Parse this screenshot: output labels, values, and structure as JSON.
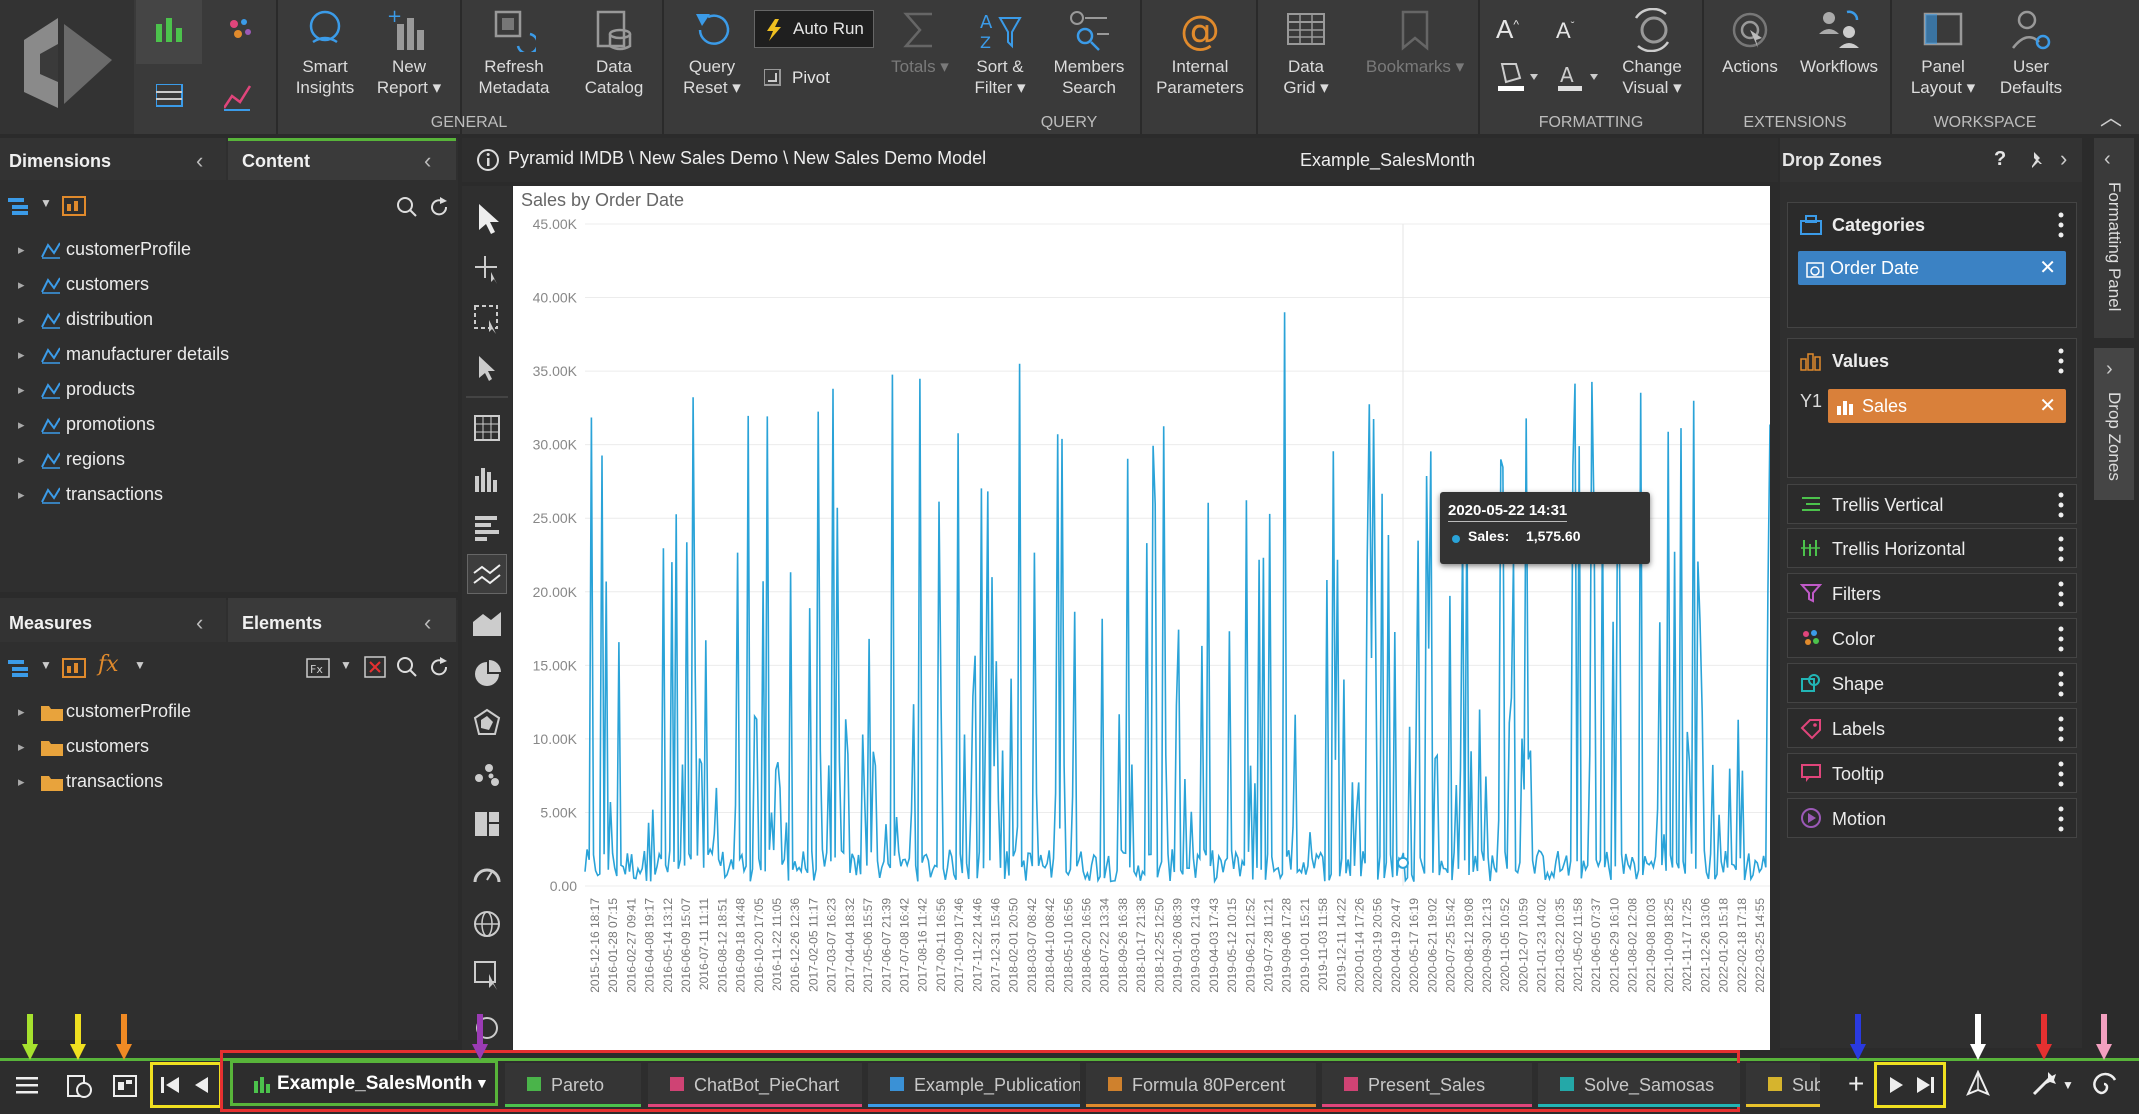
{
  "ribbon": {
    "buttons": [
      {
        "id": "smart-insights",
        "line1": "Smart",
        "line2": "Insights"
      },
      {
        "id": "new-report",
        "line1": "New",
        "line2": "Report ▾"
      },
      {
        "id": "refresh-metadata",
        "line1": "Refresh",
        "line2": "Metadata"
      },
      {
        "id": "data-catalog",
        "line1": "Data",
        "line2": "Catalog"
      },
      {
        "id": "query-reset",
        "line1": "Query",
        "line2": "Reset ▾"
      },
      {
        "id": "totals",
        "line1": "Totals ▾",
        "line2": ""
      },
      {
        "id": "sort-filter",
        "line1": "Sort &",
        "line2": "Filter ▾"
      },
      {
        "id": "members-search",
        "line1": "Members",
        "line2": "Search"
      },
      {
        "id": "internal-parameters",
        "line1": "Internal",
        "line2": "Parameters"
      },
      {
        "id": "data-grid",
        "line1": "Data",
        "line2": "Grid ▾"
      },
      {
        "id": "bookmarks",
        "line1": "Bookmarks ▾",
        "line2": ""
      },
      {
        "id": "change-visual",
        "line1": "Change",
        "line2": "Visual ▾"
      },
      {
        "id": "actions",
        "line1": "Actions",
        "line2": ""
      },
      {
        "id": "workflows",
        "line1": "Workflows",
        "line2": ""
      },
      {
        "id": "panel-layout",
        "line1": "Panel",
        "line2": "Layout ▾"
      },
      {
        "id": "user-defaults",
        "line1": "User",
        "line2": "Defaults"
      }
    ],
    "auto_run": "Auto Run",
    "pivot": "Pivot",
    "groups": {
      "general": "GENERAL",
      "query": "QUERY",
      "formatting": "FORMATTING",
      "extensions": "EXTENSIONS",
      "workspace": "WORKSPACE"
    },
    "font_up": "A",
    "font_down": "A"
  },
  "left": {
    "dimensions_title": "Dimensions",
    "content_title": "Content",
    "dimensions": [
      "customerProfile",
      "customers",
      "distribution",
      "manufacturer details",
      "products",
      "promotions",
      "regions",
      "transactions"
    ],
    "measures_title": "Measures",
    "elements_title": "Elements",
    "measures": [
      "customerProfile",
      "customers",
      "transactions"
    ]
  },
  "breadcrumb": "Pyramid IMDB \\ New Sales Demo \\ New Sales Demo Model",
  "report_name": "Example_SalesMonth",
  "chart_data": {
    "type": "line",
    "title": "Sales by Order Date",
    "ylim": [
      0,
      45000
    ],
    "yticks": [
      "45.00K",
      "40.00K",
      "35.00K",
      "30.00K",
      "25.00K",
      "20.00K",
      "15.00K",
      "10.00K",
      "5.00K",
      "0.00"
    ],
    "xticks": [
      "2015-12-16 18:17",
      "2016-01-28 07:15",
      "2016-02-27 09:41",
      "2016-04-08 19:17",
      "2016-05-14 13:12",
      "2016-06-09 15:07",
      "2016-07-11 11:11",
      "2016-08-12 18:51",
      "2016-09-18 14:48",
      "2016-10-20 17:05",
      "2016-11-22 11:05",
      "2016-12-26 12:36",
      "2017-02-05 11:17",
      "2017-03-07 16:23",
      "2017-04-04 18:32",
      "2017-05-06 15:57",
      "2017-06-07 21:39",
      "2017-07-08 16:42",
      "2017-08-16 11:42",
      "2017-09-11 16:56",
      "2017-10-09 17:46",
      "2017-11-22 14:46",
      "2017-12-31 15:46",
      "2018-02-01 20:50",
      "2018-03-07 08:42",
      "2018-04-10 08:42",
      "2018-05-10 16:56",
      "2018-06-20 16:56",
      "2018-07-22 13:34",
      "2018-09-26 16:38",
      "2018-10-17 21:38",
      "2018-12-25 12:50",
      "2019-01-26 08:39",
      "2019-03-01 21:43",
      "2019-04-03 17:43",
      "2019-05-12 10:15",
      "2019-06-21 12:52",
      "2019-07-28 11:21",
      "2019-09-06 17:28",
      "2019-10-01 15:21",
      "2019-11-03 11:58",
      "2019-12-11 14:22",
      "2020-01-14 17:26",
      "2020-03-19 20:56",
      "2020-04-19 20:47",
      "2020-05-17 16:19",
      "2020-06-21 19:02",
      "2020-07-25 15:42",
      "2020-08-12 19:08",
      "2020-09-30 12:13",
      "2020-11-05 10:52",
      "2020-12-07 10:59",
      "2021-01-23 14:02",
      "2021-03-22 10:35",
      "2021-05-02 11:58",
      "2021-06-05 07:37",
      "2021-06-29 16:10",
      "2021-08-02 12:08",
      "2021-09-08 10:03",
      "2021-10-09 18:25",
      "2021-11-17 17:25",
      "2021-12-26 13:06",
      "2022-01-20 15:18",
      "2022-02-18 17:18",
      "2022-03-25 14:55"
    ],
    "series": [
      {
        "name": "Sales",
        "color": "#2aa3d8"
      }
    ],
    "tooltip": {
      "title": "2020-05-22 14:31",
      "label": "Sales:",
      "value": "1,575.60"
    }
  },
  "dropzones": {
    "title": "Drop Zones",
    "help": "?",
    "categories": "Categories",
    "category_chip": "Order Date",
    "values": "Values",
    "values_axis": "Y1",
    "value_chip": "Sales",
    "zones": [
      "Trellis Vertical",
      "Trellis Horizontal",
      "Filters",
      "Color",
      "Shape",
      "Labels",
      "Tooltip",
      "Motion"
    ]
  },
  "side_tabs": {
    "formatting": "Formatting Panel",
    "dropzones": "Drop Zones"
  },
  "tabs": [
    {
      "label": "Example_SalesMonth",
      "active": true,
      "icon_color": "#4cc24c"
    },
    {
      "label": "Pareto",
      "active": false,
      "icon_color": "#4cc24c",
      "underline": "#4cc24c"
    },
    {
      "label": "ChatBot_PieChart",
      "active": false,
      "icon_color": "#e0457b",
      "underline": "#e0457b"
    },
    {
      "label": "Example_Publication",
      "active": false,
      "icon_color": "#3b9be8",
      "underline": "#3b9be8"
    },
    {
      "label": "Formula 80Percent",
      "active": false,
      "icon_color": "#e08a2c",
      "underline": "#e08a2c"
    },
    {
      "label": "Present_Sales",
      "active": false,
      "icon_color": "#e0457b",
      "underline": "#e0457b"
    },
    {
      "label": "Solve_Samosas",
      "active": false,
      "icon_color": "#22b5b5",
      "underline": "#22b5b5"
    },
    {
      "label": "Subje",
      "active": false,
      "icon_color": "#e8c22c",
      "underline": "#e8c22c"
    }
  ],
  "colors": {
    "accent_green": "#58b43a",
    "chip_blue": "#3b82c4",
    "chip_orange": "#d9803a",
    "highlight_red": "#e53030",
    "highlight_yellow": "#f0e020"
  }
}
